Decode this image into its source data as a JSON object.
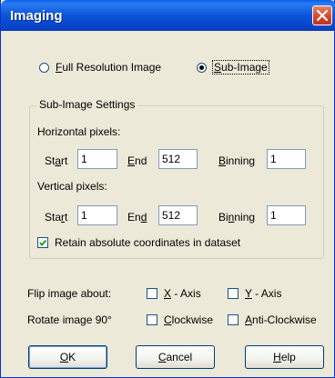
{
  "window": {
    "title": "Imaging",
    "close_icon": "close-icon"
  },
  "mode": {
    "full_resolution": {
      "prefix": "",
      "accel": "F",
      "rest": "ull Resolution Image",
      "selected": false
    },
    "sub_image": {
      "prefix": "",
      "accel": "S",
      "rest": "ub-Image",
      "selected": true
    }
  },
  "sub_image_settings": {
    "group_label": "Sub-Image Settings",
    "horizontal": {
      "heading": "Horizontal pixels:",
      "start_label": {
        "prefix": "St",
        "accel": "a",
        "rest": "rt"
      },
      "start_value": "1",
      "end_label": {
        "prefix": "",
        "accel": "E",
        "rest": "nd"
      },
      "end_value": "512",
      "binning_label": {
        "prefix": "",
        "accel": "B",
        "rest": "inning"
      },
      "binning_value": "1"
    },
    "vertical": {
      "heading": "Vertical pixels:",
      "start_label": {
        "prefix": "Sta",
        "accel": "r",
        "rest": "t"
      },
      "start_value": "1",
      "end_label": {
        "prefix": "En",
        "accel": "d",
        "rest": ""
      },
      "end_value": "512",
      "binning_label": {
        "prefix": "Bi",
        "accel": "n",
        "rest": "ning"
      },
      "binning_value": "1"
    },
    "retain": {
      "label": "Retain absolute coordinates in dataset",
      "checked": true
    }
  },
  "flip": {
    "label": "Flip image about:",
    "x_axis": {
      "prefix": "",
      "accel": "X",
      "rest": " - Axis",
      "checked": false
    },
    "y_axis": {
      "prefix": "",
      "accel": "Y",
      "rest": " - Axis",
      "checked": false
    }
  },
  "rotate": {
    "label": "Rotate image 90°",
    "clockwise": {
      "prefix": "",
      "accel": "C",
      "rest": "lockwise",
      "checked": false
    },
    "anticlockwise": {
      "prefix": "",
      "accel": "A",
      "rest": "nti-Clockwise",
      "checked": false
    }
  },
  "buttons": {
    "ok": {
      "prefix": "",
      "accel": "O",
      "rest": "K"
    },
    "cancel": {
      "prefix": "",
      "accel": "C",
      "rest": "ancel"
    },
    "help": {
      "prefix": "",
      "accel": "H",
      "rest": "elp"
    }
  }
}
